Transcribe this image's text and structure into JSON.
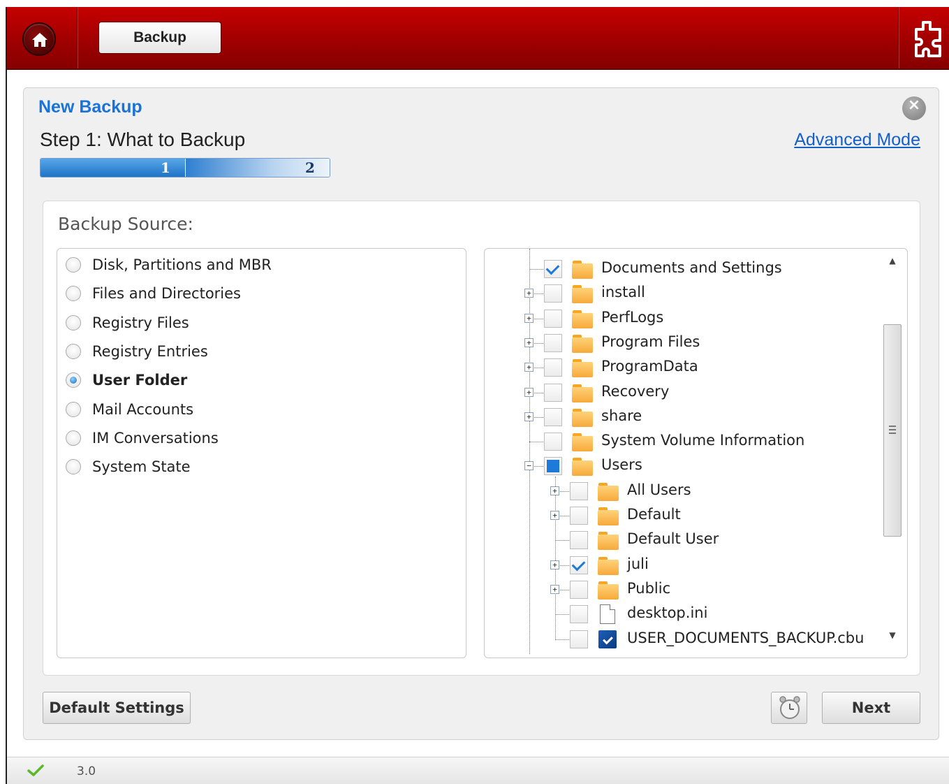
{
  "header": {
    "home_icon": "home-icon",
    "tab_label": "Backup",
    "plugin_icon": "puzzle-plugin-icon"
  },
  "panel": {
    "title": "New Backup",
    "step_title": "Step 1: What to Backup",
    "advanced_mode_label": "Advanced Mode",
    "close_icon": "close-icon",
    "progress": {
      "current_step": 1,
      "total_steps": 2,
      "step1_label": "1",
      "step2_label": "2"
    }
  },
  "source": {
    "label": "Backup Source:",
    "types": [
      {
        "label": "Disk, Partitions and MBR",
        "selected": false
      },
      {
        "label": "Files and Directories",
        "selected": false
      },
      {
        "label": "Registry Files",
        "selected": false
      },
      {
        "label": "Registry Entries",
        "selected": false
      },
      {
        "label": "User Folder",
        "selected": true
      },
      {
        "label": "Mail Accounts",
        "selected": false
      },
      {
        "label": "IM Conversations",
        "selected": false
      },
      {
        "label": "System State",
        "selected": false
      }
    ]
  },
  "tree": {
    "items": [
      {
        "label": "Documents and Settings",
        "depth": 0,
        "expandable": false,
        "state": "checked",
        "icon": "folder-icon"
      },
      {
        "label": "install",
        "depth": 0,
        "expandable": true,
        "expanded": false,
        "state": "unchecked",
        "icon": "folder-icon"
      },
      {
        "label": "PerfLogs",
        "depth": 0,
        "expandable": true,
        "expanded": false,
        "state": "unchecked",
        "icon": "folder-icon"
      },
      {
        "label": "Program Files",
        "depth": 0,
        "expandable": true,
        "expanded": false,
        "state": "unchecked",
        "icon": "folder-icon"
      },
      {
        "label": "ProgramData",
        "depth": 0,
        "expandable": true,
        "expanded": false,
        "state": "unchecked",
        "icon": "folder-icon"
      },
      {
        "label": "Recovery",
        "depth": 0,
        "expandable": true,
        "expanded": false,
        "state": "unchecked",
        "icon": "folder-icon"
      },
      {
        "label": "share",
        "depth": 0,
        "expandable": true,
        "expanded": false,
        "state": "unchecked",
        "icon": "folder-icon"
      },
      {
        "label": "System Volume Information",
        "depth": 0,
        "expandable": false,
        "state": "unchecked",
        "icon": "folder-icon"
      },
      {
        "label": "Users",
        "depth": 0,
        "expandable": true,
        "expanded": true,
        "state": "partial",
        "icon": "folder-icon"
      },
      {
        "label": "All Users",
        "depth": 1,
        "expandable": true,
        "expanded": false,
        "state": "unchecked",
        "icon": "folder-icon"
      },
      {
        "label": "Default",
        "depth": 1,
        "expandable": true,
        "expanded": false,
        "state": "unchecked",
        "icon": "folder-icon"
      },
      {
        "label": "Default User",
        "depth": 1,
        "expandable": false,
        "state": "unchecked",
        "icon": "folder-icon"
      },
      {
        "label": "juli",
        "depth": 1,
        "expandable": true,
        "expanded": false,
        "state": "checked",
        "icon": "folder-icon"
      },
      {
        "label": "Public",
        "depth": 1,
        "expandable": true,
        "expanded": false,
        "state": "unchecked",
        "icon": "folder-icon"
      },
      {
        "label": "desktop.ini",
        "depth": 1,
        "expandable": false,
        "state": "unchecked",
        "icon": "file-icon"
      },
      {
        "label": "USER_DOCUMENTS_BACKUP.cbu",
        "depth": 1,
        "expandable": false,
        "state": "unchecked",
        "icon": "cbu-file-icon"
      }
    ]
  },
  "buttons": {
    "default_settings": "Default Settings",
    "next": "Next",
    "schedule_icon": "alarm-clock-icon"
  },
  "status": {
    "ok_icon": "checkmark-icon",
    "version": "3.0"
  },
  "colors": {
    "header_red": "#a00000",
    "title_blue": "#1a73d9",
    "link_blue": "#1560c8",
    "check_blue": "#1e7ad8",
    "status_green": "#5cb82a"
  }
}
